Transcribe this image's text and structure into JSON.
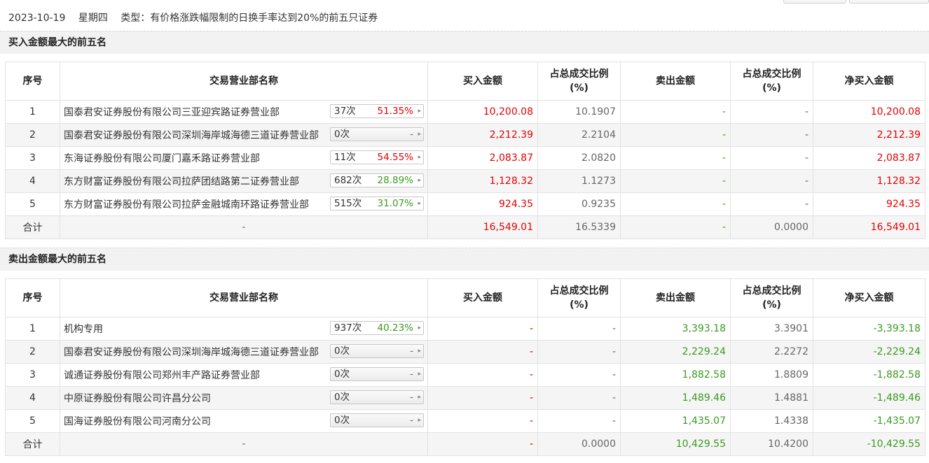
{
  "header": {
    "date": "2023-10-19",
    "weekday": "星期四",
    "type": "类型：有价格涨跌幅限制的日换手率达到20%的前五只证券"
  },
  "columns": {
    "seq": "序号",
    "dept": "交易营业部名称",
    "buy": "买入金额",
    "buy_pct_1": "占总成交比例",
    "buy_pct_2": "(%)",
    "sell": "卖出金额",
    "sell_pct_1": "占总成交比例",
    "sell_pct_2": "(%)",
    "net": "净买入金额"
  },
  "buy_top5": {
    "title": "买入金额最大的前五名",
    "rows": [
      {
        "seq": "1",
        "name": "国泰君安证券股份有限公司三亚迎宾路证券营业部",
        "count": "37次",
        "rate": "51.35%",
        "rate_color": "red",
        "buy": "10,200.08",
        "buy_pct": "10.1907",
        "sell": "-",
        "sell_pct": "-",
        "net": "10,200.08"
      },
      {
        "seq": "2",
        "name": "国泰君安证券股份有限公司深圳海岸城海德三道证券营业部",
        "count": "0次",
        "rate": "-",
        "rate_color": "gray",
        "buy": "2,212.39",
        "buy_pct": "2.2104",
        "sell": "-",
        "sell_pct": "-",
        "net": "2,212.39"
      },
      {
        "seq": "3",
        "name": "东海证券股份有限公司厦门嘉禾路证券营业部",
        "count": "11次",
        "rate": "54.55%",
        "rate_color": "red",
        "buy": "2,083.87",
        "buy_pct": "2.0820",
        "sell": "-",
        "sell_pct": "-",
        "net": "2,083.87"
      },
      {
        "seq": "4",
        "name": "东方财富证券股份有限公司拉萨团结路第二证券营业部",
        "count": "682次",
        "rate": "28.89%",
        "rate_color": "green",
        "buy": "1,128.32",
        "buy_pct": "1.1273",
        "sell": "-",
        "sell_pct": "-",
        "net": "1,128.32"
      },
      {
        "seq": "5",
        "name": "东方财富证券股份有限公司拉萨金融城南环路证券营业部",
        "count": "515次",
        "rate": "31.07%",
        "rate_color": "green",
        "buy": "924.35",
        "buy_pct": "0.9235",
        "sell": "-",
        "sell_pct": "-",
        "net": "924.35"
      }
    ],
    "total": {
      "label": "合计",
      "name": "-",
      "buy": "16,549.01",
      "buy_pct": "16.5339",
      "sell": "-",
      "sell_pct": "0.0000",
      "net": "16,549.01"
    }
  },
  "sell_top5": {
    "title": "卖出金额最大的前五名",
    "rows": [
      {
        "seq": "1",
        "name": "机构专用",
        "count": "937次",
        "rate": "40.23%",
        "rate_color": "green",
        "buy": "-",
        "buy_pct": "-",
        "sell": "3,393.18",
        "sell_pct": "3.3901",
        "net": "-3,393.18"
      },
      {
        "seq": "2",
        "name": "国泰君安证券股份有限公司深圳海岸城海德三道证券营业部",
        "count": "0次",
        "rate": "-",
        "rate_color": "gray",
        "buy": "-",
        "buy_pct": "-",
        "sell": "2,229.24",
        "sell_pct": "2.2272",
        "net": "-2,229.24"
      },
      {
        "seq": "3",
        "name": "诚通证券股份有限公司郑州丰产路证券营业部",
        "count": "0次",
        "rate": "-",
        "rate_color": "gray",
        "buy": "-",
        "buy_pct": "-",
        "sell": "1,882.58",
        "sell_pct": "1.8809",
        "net": "-1,882.58"
      },
      {
        "seq": "4",
        "name": "中原证券股份有限公司许昌分公司",
        "count": "0次",
        "rate": "-",
        "rate_color": "gray",
        "buy": "-",
        "buy_pct": "-",
        "sell": "1,489.46",
        "sell_pct": "1.4881",
        "net": "-1,489.46"
      },
      {
        "seq": "5",
        "name": "国海证券股份有限公司河南分公司",
        "count": "0次",
        "rate": "-",
        "rate_color": "gray",
        "buy": "-",
        "buy_pct": "-",
        "sell": "1,435.07",
        "sell_pct": "1.4338",
        "net": "-1,435.07"
      }
    ],
    "total": {
      "label": "合计",
      "name": "-",
      "buy": "-",
      "buy_pct": "0.0000",
      "sell": "10,429.55",
      "sell_pct": "10.4200",
      "net": "-10,429.55"
    }
  },
  "colors": {
    "red": "#e60000",
    "green": "#3a9a1f",
    "section_bg": "#f2f2f2",
    "alt_row": "#f5f5f5"
  },
  "icons": {
    "badge_arrow": "chevron-right-icon"
  }
}
